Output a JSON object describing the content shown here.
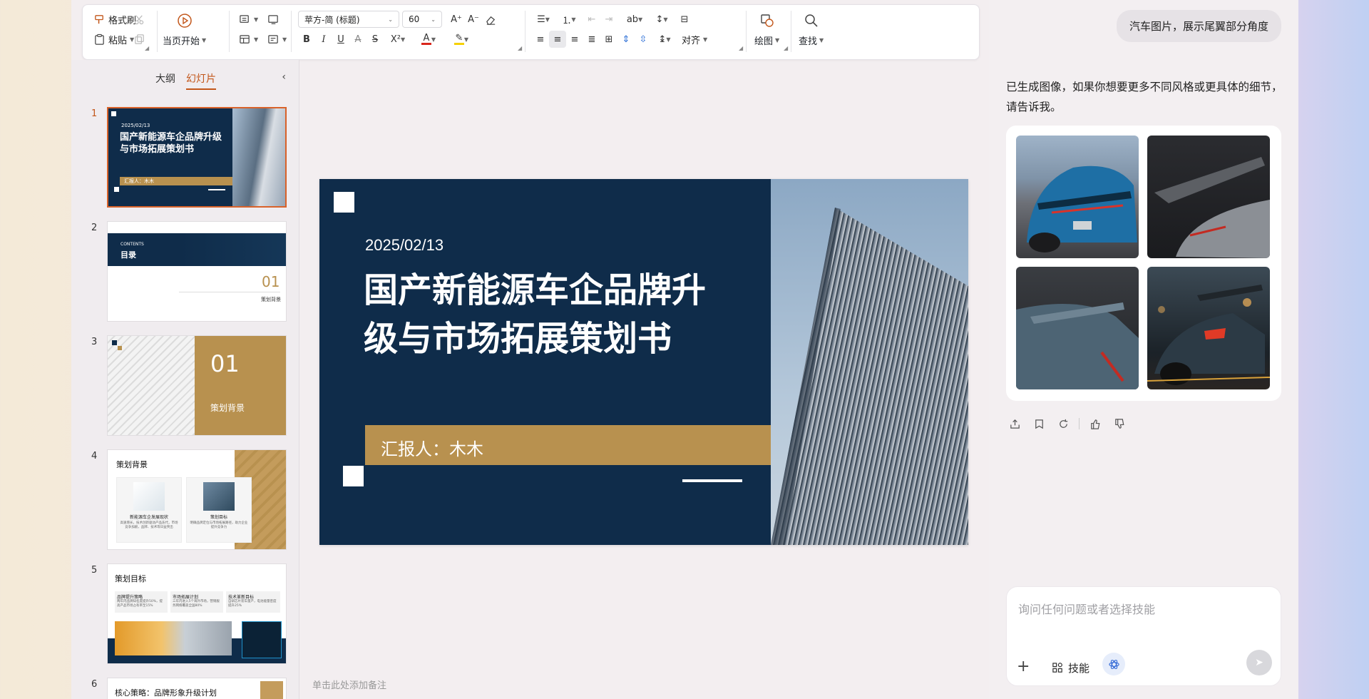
{
  "ribbon": {
    "format_painter": "格式刷",
    "paste": "粘贴",
    "start_from_current": "当页开始",
    "font_name": "苹方-简 (标题)",
    "font_size": "60",
    "align": "对齐",
    "draw": "绘图",
    "find": "查找",
    "bold": "B",
    "italic": "I",
    "underline": "U",
    "strike": "S",
    "superscript": "X²",
    "font_color_letter": "A",
    "font_color": "#d9261c",
    "highlight_color": "#f5d000"
  },
  "sidepanel": {
    "tab_outline": "大纲",
    "tab_slides": "幻灯片",
    "slides": [
      {
        "num": "1",
        "date": "2025/02/13",
        "title": "国产新能源车企品牌升级与市场拓展策划书",
        "reporter": "汇报人：木木"
      },
      {
        "num": "2",
        "en": "CONTENTS",
        "title": "目录",
        "index": "01",
        "sub": "策划背景"
      },
      {
        "num": "3",
        "index": "01",
        "sub": "策划背景"
      },
      {
        "num": "4",
        "title": "策划背景",
        "card1": "新能源车企发展现状",
        "card1_text": "高速增长，技术创新驱动产品迭代，市场竞争加剧，品牌、技术等日益突出",
        "card2": "策划目标",
        "card2_text": "明确品牌定位与市场拓展路径，助力企业提升竞争力"
      },
      {
        "num": "5",
        "title": "策划目标",
        "c1": "品牌提升策略",
        "c1_text": "两年内品牌知名度提升50%，提高产品市场占有率至15%",
        "c2": "市场拓展计划",
        "c2_text": "三年内进入5个海外市场，营销服务网络覆盖全国80%",
        "c3": "技术革新目标",
        "c3_text": "自研芯片装车量产，电池能量密度提升25%"
      },
      {
        "num": "6",
        "title": "核心策略：品牌形象升级计划"
      }
    ]
  },
  "slide": {
    "date": "2025/02/13",
    "title_line1": "国产新能源车企品牌升",
    "title_line2": "级与市场拓展策划书",
    "reporter": "汇报人：木木",
    "colors": {
      "navy": "#0f2c4a",
      "gold": "#b8914f"
    }
  },
  "notes_placeholder": "单击此处添加备注",
  "chat": {
    "user_message": "汽车图片，展示尾翼部分角度",
    "reply": "已生成图像，如果你想要更多不同风格或更具体的细节，请告诉我。",
    "input_placeholder": "询问任何问题或者选择技能",
    "skills_label": "技能",
    "images": [
      "blue-sports-car-rear",
      "grey-car-spoiler-closeup",
      "teal-car-spoiler-detail",
      "dark-sports-car-taillight-night"
    ]
  }
}
